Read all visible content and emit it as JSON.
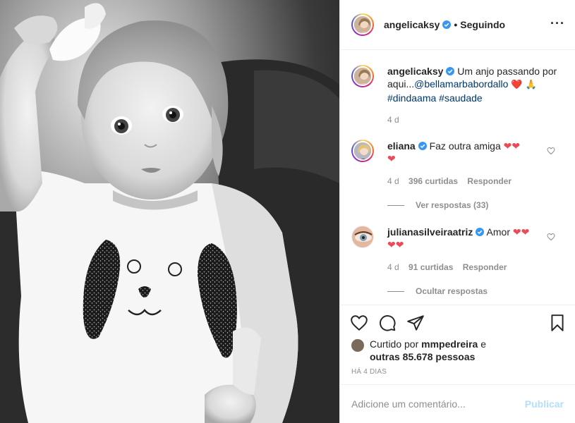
{
  "post": {
    "author": "angelicaksy",
    "separator": "•",
    "follow_state": "Seguindo",
    "more_icon": "more-icon"
  },
  "caption": {
    "user": "angelicaksy",
    "text_before": "Um anjo passando por aqui...",
    "mention": "@bellamarbabordallo",
    "emojis": "❤️ 🙏",
    "hashtags": [
      "#dindaama",
      "#saudade"
    ],
    "age": "4 d"
  },
  "comments": [
    {
      "user": "eliana",
      "text": "Faz outra amiga",
      "hearts": 3,
      "age": "4 d",
      "likes": "396 curtidas",
      "reply": "Responder",
      "replies_link": "Ver respostas (33)"
    },
    {
      "user": "julianasilveiraatriz",
      "text": "Amor",
      "hearts": 4,
      "age": "4 d",
      "likes": "91 curtidas",
      "reply": "Responder",
      "replies_link": "Ocultar respostas"
    }
  ],
  "liked_by": {
    "prefix": "Curtido por",
    "user": "mmpedreira",
    "and": "e",
    "others": "outras 85.678 pessoas"
  },
  "timestamp": "HÁ 4 DIAS",
  "add_comment": {
    "placeholder": "Adicione um comentário...",
    "publish": "Publicar"
  },
  "colors": {
    "verified": "#3897f0",
    "heart_red": "#ed4956",
    "muted": "#8e8e8e",
    "link": "#00376b",
    "publish_disabled": "#b2dffc"
  }
}
